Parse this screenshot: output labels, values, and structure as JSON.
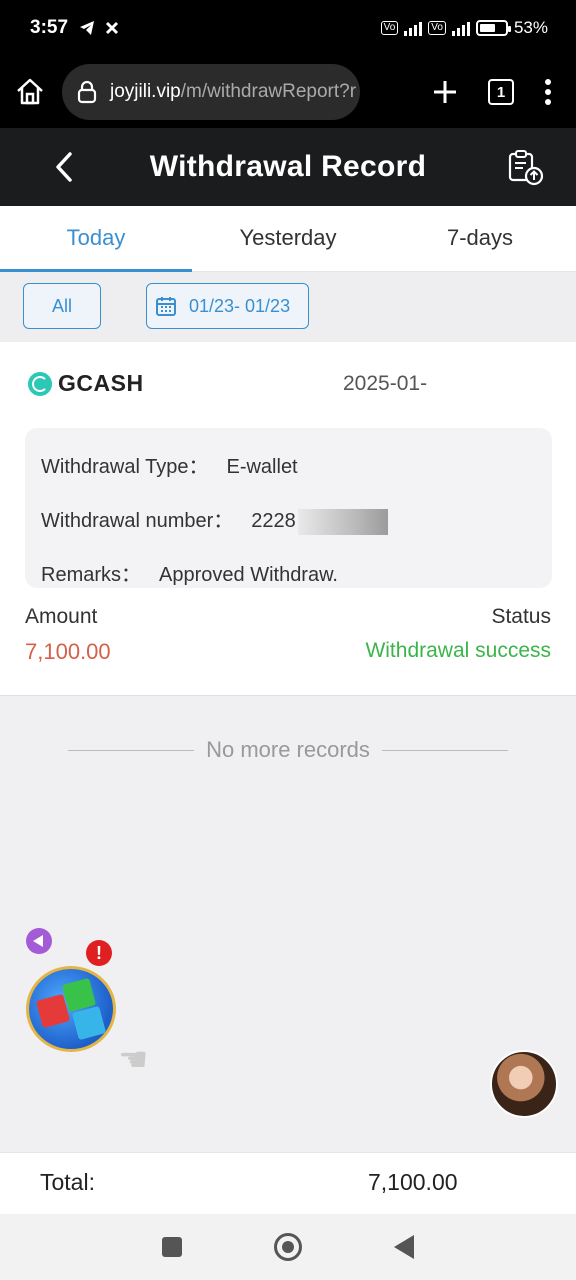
{
  "status_bar": {
    "time": "3:57",
    "battery": "53%"
  },
  "browser": {
    "url_domain": "joyjili.vip",
    "url_path": "/m/withdrawReport?r",
    "tab_count": "1"
  },
  "header": {
    "title": "Withdrawal Record"
  },
  "tabs": [
    {
      "label": "Today"
    },
    {
      "label": "Yesterday"
    },
    {
      "label": "7-days"
    }
  ],
  "filters": {
    "all_label": "All",
    "date_range": "01/23- 01/23"
  },
  "record": {
    "method": "GCASH",
    "date": "2025-01-",
    "type_label": "Withdrawal Type：",
    "type_value": "E-wallet",
    "number_label": "Withdrawal number：",
    "number_value": "2228",
    "remarks_label": "Remarks：",
    "remarks_value": "Approved Withdraw.",
    "amount_label": "Amount",
    "amount_value": "7,100.00",
    "status_label": "Status",
    "status_value": "Withdrawal success"
  },
  "no_more": "No more records",
  "total": {
    "label": "Total:",
    "value": "7,100.00"
  },
  "floating": {
    "alert_badge": "!"
  },
  "colors": {
    "accent": "#3a8fd0",
    "success": "#3bb54a",
    "amount": "#d4614a",
    "header_bg": "#1b1c1e"
  }
}
